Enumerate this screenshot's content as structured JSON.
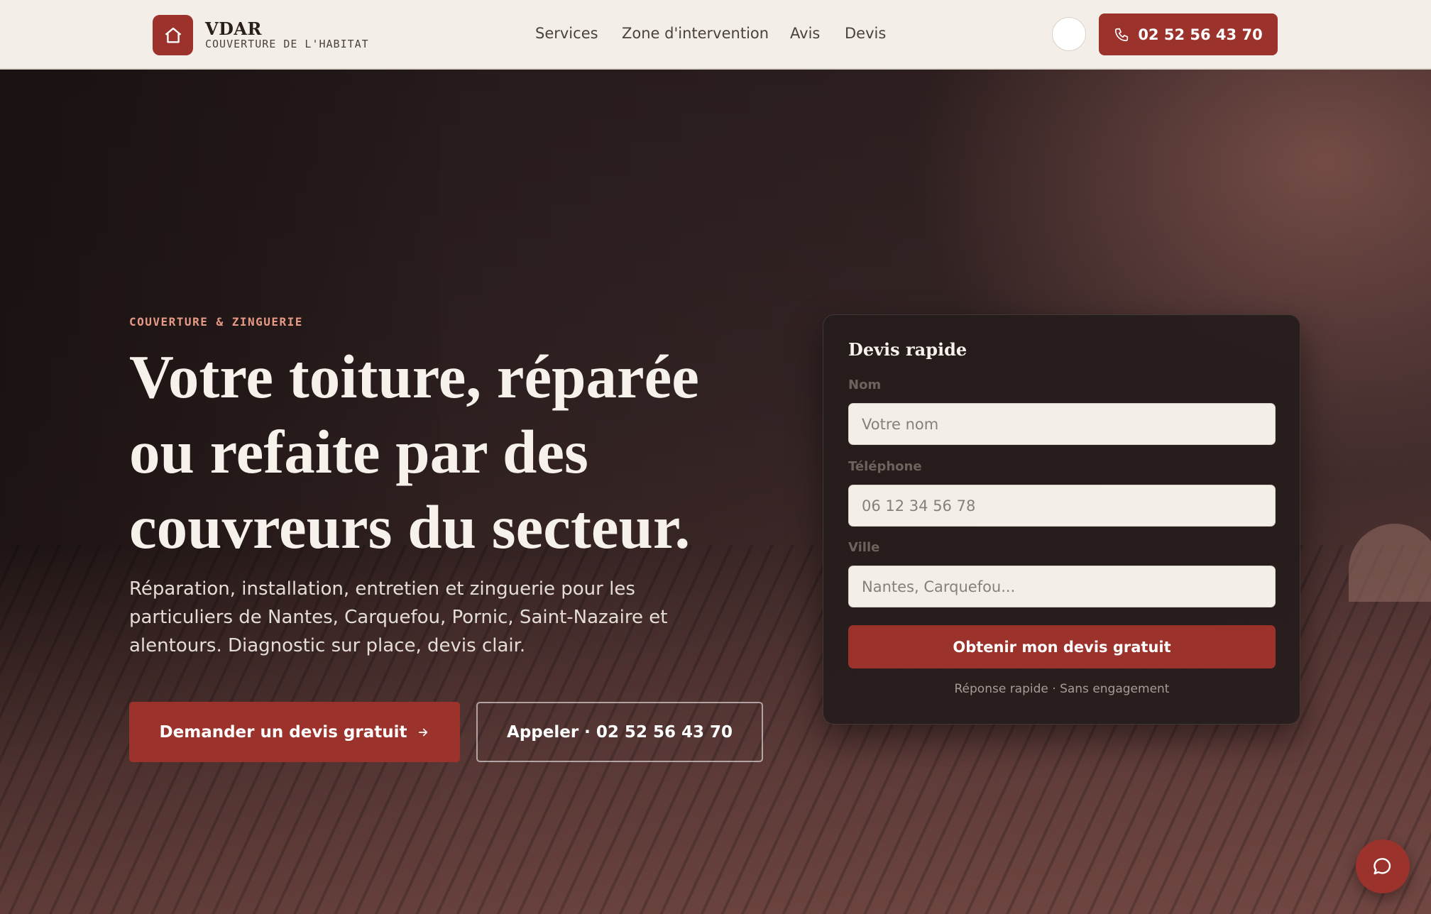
{
  "header": {
    "brand_name": "VDAR",
    "brand_tagline": "COUVERTURE DE L'HABITAT",
    "logo_icon": "house-icon",
    "nav": [
      {
        "label": "Services"
      },
      {
        "label": "Zone d'intervention"
      },
      {
        "label": "Avis"
      },
      {
        "label": "Devis"
      }
    ],
    "theme_toggle_icon": "moon-icon",
    "call_button": {
      "icon": "phone-icon",
      "label": "02 52 56 43 70"
    }
  },
  "hero": {
    "eyebrow": "COUVERTURE & ZINGUERIE",
    "headline_lines": [
      "Votre toiture, réparée",
      "ou refaite par des",
      "couvreurs du secteur."
    ],
    "lead": "Réparation, installation, entretien et zinguerie pour les particuliers de Nantes, Carquefou, Pornic, Saint-Nazaire et alentours. Diagnostic sur place, devis clair.",
    "primary_button": {
      "label": "Demander un devis gratuit",
      "icon": "arrow-right-icon"
    },
    "secondary_button": {
      "label": "Appeler · 02 52 56 43 70"
    }
  },
  "quote_form": {
    "title": "Devis rapide",
    "fields": [
      {
        "label": "Nom",
        "placeholder": "Votre nom",
        "value": ""
      },
      {
        "label": "Téléphone",
        "placeholder": "06 12 34 56 78",
        "value": ""
      },
      {
        "label": "Ville",
        "placeholder": "Nantes, Carquefou...",
        "value": ""
      }
    ],
    "submit_label": "Obtenir mon devis gratuit",
    "note": "Réponse rapide · Sans engagement"
  },
  "chat_button": {
    "icon": "chat-bubble-icon"
  },
  "colors": {
    "accent": "#9b322b",
    "header_bg": "#f3efe8",
    "eyebrow": "#e79a86",
    "card_bg": "#261c1c"
  }
}
